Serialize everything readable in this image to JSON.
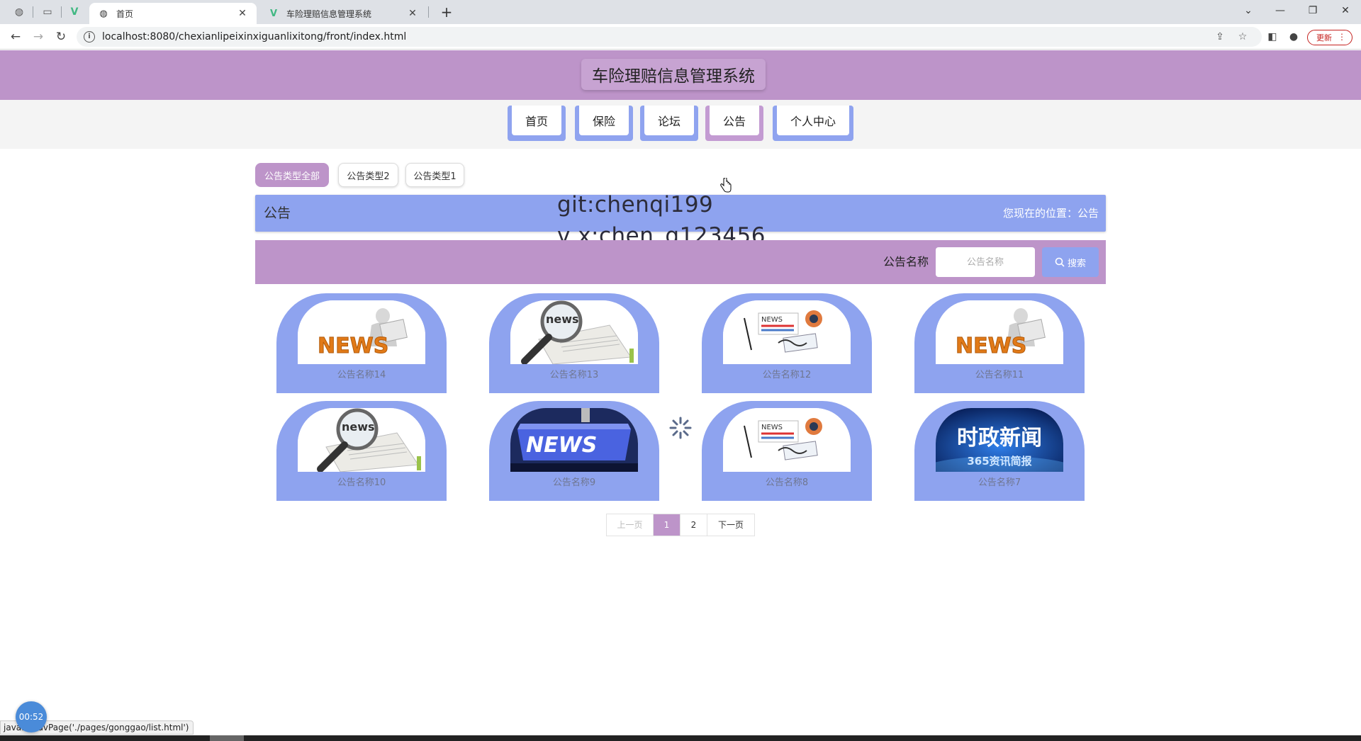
{
  "browser": {
    "tabs": [
      {
        "title": "首页",
        "active": true
      },
      {
        "title": "车险理赔信息管理系统",
        "active": false
      }
    ],
    "url": "localhost:8080/chexianlipeixinxiguanlixitong/front/index.html",
    "update_label": "更新",
    "status_text": "java… navPage('./pages/gonggao/list.html')",
    "timer": "00:52"
  },
  "site": {
    "title": "车险理赔信息管理系统",
    "nav": [
      "首页",
      "保险",
      "论坛",
      "公告",
      "个人中心"
    ],
    "current_nav": "公告"
  },
  "categories": {
    "items": [
      "公告类型全部",
      "公告类型2",
      "公告类型1"
    ],
    "active": "公告类型全部"
  },
  "breadcrumb": {
    "section": "公告",
    "location_label": "您现在的位置：",
    "location_value": "公告"
  },
  "overlay": {
    "line1": "git:chenqi199",
    "line2": "v x:chen_q123456"
  },
  "search": {
    "label": "公告名称",
    "placeholder": "公告名称",
    "button": "搜索"
  },
  "cards": [
    {
      "caption": "公告名称14",
      "image": "news-man-reading"
    },
    {
      "caption": "公告名称13",
      "image": "news-magnifier"
    },
    {
      "caption": "公告名称12",
      "image": "news-papers-glasses"
    },
    {
      "caption": "公告名称11",
      "image": "news-man-reading"
    },
    {
      "caption": "公告名称10",
      "image": "news-magnifier"
    },
    {
      "caption": "公告名称9",
      "image": "news-keyboard-key"
    },
    {
      "caption": "公告名称8",
      "image": "news-papers-glasses"
    },
    {
      "caption": "公告名称7",
      "image": "shizheng-xinwen"
    }
  ],
  "image_text": {
    "news": "NEWS",
    "news_lower": "news",
    "shizheng": "时政新闻",
    "shizheng_sub": "365资讯简报"
  },
  "pager": {
    "prev": "上一页",
    "pages": [
      "1",
      "2"
    ],
    "current": "1",
    "next": "下一页"
  },
  "colors": {
    "header_purple": "#bd94c9",
    "card_blue": "#8ea3ef"
  }
}
